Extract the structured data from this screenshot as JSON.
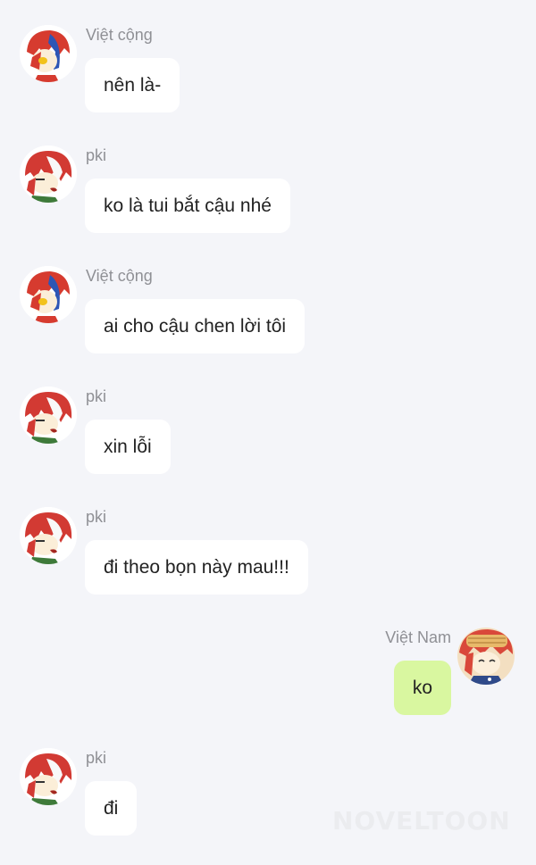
{
  "chat": {
    "messages": [
      {
        "side": "left",
        "sender": "Việt cộng",
        "text": "nên là-",
        "avatar": "viet-cong-avatar"
      },
      {
        "side": "left",
        "sender": "pki",
        "text": "ko là tui bắt cậu nhé",
        "avatar": "pki-avatar"
      },
      {
        "side": "left",
        "sender": "Việt cộng",
        "text": "ai cho cậu chen lời tôi",
        "avatar": "viet-cong-avatar"
      },
      {
        "side": "left",
        "sender": "pki",
        "text": "xin lỗi",
        "avatar": "pki-avatar"
      },
      {
        "side": "left",
        "sender": "pki",
        "text": "đi theo bọn này mau!!!",
        "avatar": "pki-avatar"
      },
      {
        "side": "right",
        "sender": "Việt Nam",
        "text": "ko",
        "avatar": "viet-nam-avatar"
      },
      {
        "side": "left",
        "sender": "pki",
        "text": "đi",
        "avatar": "pki-avatar"
      }
    ]
  },
  "watermark": "NOVELTOON",
  "colors": {
    "background": "#f4f5f9",
    "left_bubble": "#ffffff",
    "right_bubble": "#d9f7a0",
    "sender_name": "#8f9095"
  }
}
